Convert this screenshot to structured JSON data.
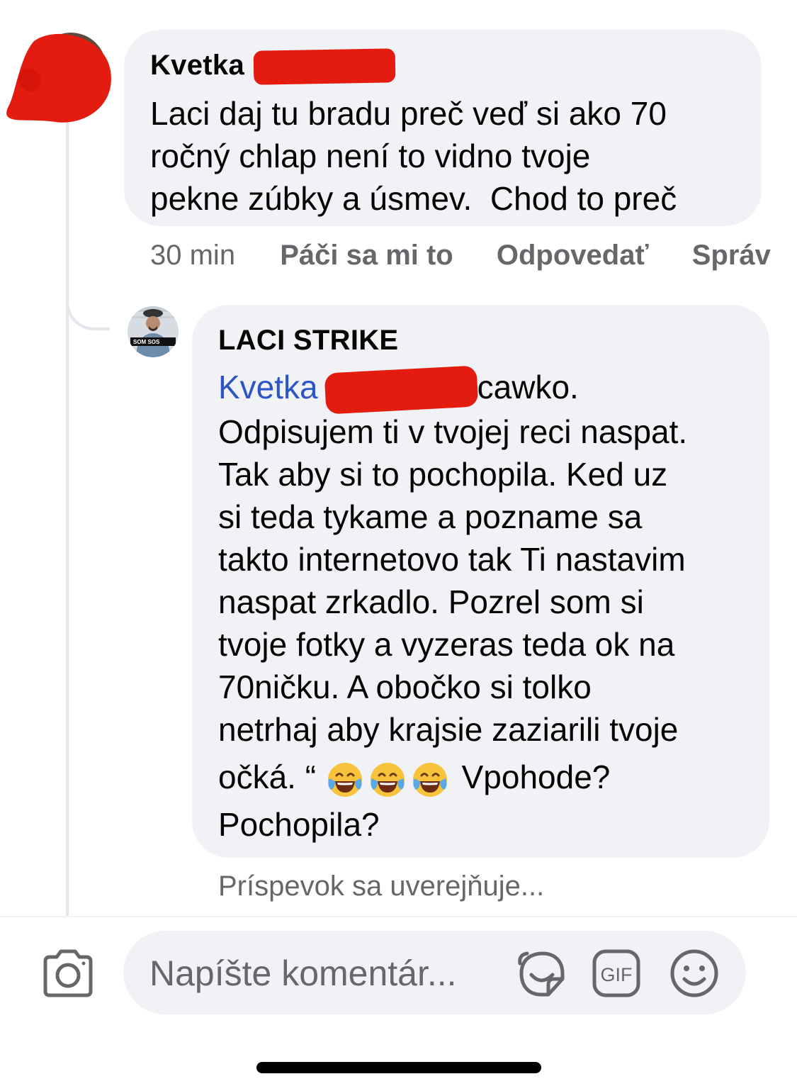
{
  "comment": {
    "author": "Kvetka",
    "text_lines": [
      "Laci daj tu bradu preč veď si ako 70",
      "ročný chlap není to vidno tvoje",
      "pekne zúbky a úsmev.  Chod to preč"
    ],
    "time": "30 min",
    "like_label": "Páči sa mi to",
    "reply_label": "Odpovedať",
    "more_label": "Správ"
  },
  "reply": {
    "author": "LACI STRIKE",
    "mention": "Kvetka",
    "first_line_rest": "cawko.",
    "text_lines": [
      "Odpisujem ti v tvojej reci naspat.",
      "Tak aby si to pochopila. Ked uz",
      "si teda tykame a pozname sa",
      "takto internetovo tak Ti nastavim",
      "naspat zrkadlo. Pozrel som si",
      "tvoje fotky a vyzeras teda ok na",
      "70ničku. A obočko si tolko",
      "netrhaj aby krajsie zaziarili tvoje"
    ],
    "line_before_emoji": "očká. “",
    "line_after_emoji": "Vpohode?",
    "last_line": "Pochopila?",
    "emoji_name": "face-with-tears-of-joy",
    "emoji_count": 3,
    "status": "Príspevok sa uverejňuje..."
  },
  "composer": {
    "placeholder": "Napíšte komentár...",
    "gif_label": "GIF"
  },
  "colors": {
    "bubble": "#f0f2f5",
    "mention": "#2d55c4",
    "meta": "#65676b",
    "redaction": "#e31c0f"
  }
}
